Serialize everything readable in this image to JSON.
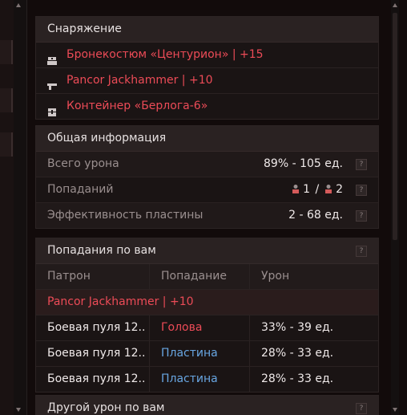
{
  "equipment": {
    "title": "Снаряжение",
    "items": [
      {
        "icon": "armor-icon",
        "label": "Бронекостюм «Центурион» | +15"
      },
      {
        "icon": "gun-icon",
        "label": "Pancor Jackhammer | +10"
      },
      {
        "icon": "container-icon",
        "label": "Контейнер «Берлога-6»"
      }
    ]
  },
  "general": {
    "title": "Общая информация",
    "rows": [
      {
        "label": "Всего урона",
        "value": "89% - 105 ед."
      },
      {
        "label": "Попаданий",
        "value_a": "1",
        "sep": "/",
        "value_b": "2"
      },
      {
        "label": "Эффективность пластины",
        "value": "2 - 68 ед."
      }
    ],
    "help": "?"
  },
  "hits": {
    "title": "Попадания по вам",
    "columns": [
      "Патрон",
      "Попадание",
      "Урон"
    ],
    "weapon": "Pancor Jackhammer | +10",
    "rows": [
      {
        "ammo": "Боевая пуля 12..",
        "hit": "Голова",
        "dmg": "33% - 39 ед.",
        "hit_color": "#ec4b57"
      },
      {
        "ammo": "Боевая пуля 12..",
        "hit": "Пластина",
        "dmg": "28% - 33 ед.",
        "hit_color": "#68a6e2"
      },
      {
        "ammo": "Боевая пуля 12..",
        "hit": "Пластина",
        "dmg": "28% - 33 ед.",
        "hit_color": "#68a6e2"
      }
    ],
    "help": "?"
  },
  "other": {
    "title": "Другой урон по вам",
    "help": "?"
  },
  "colors": {
    "accent_red": "#ec4b57",
    "accent_blue": "#68a6e2",
    "panel_bg": "#1a1414"
  }
}
